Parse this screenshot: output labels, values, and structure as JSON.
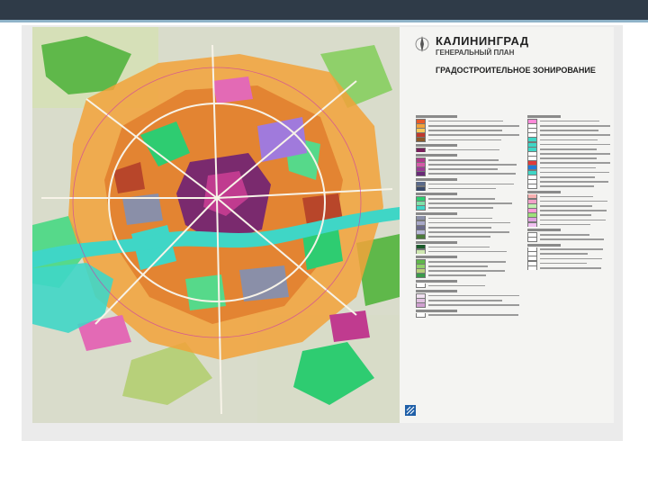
{
  "header": {
    "bar_color": "#2f3b48",
    "accent_line": "#8fb3c8"
  },
  "title": {
    "city": "КАЛИНИНГРАД",
    "plan": "ГЕНЕРАЛЬНЫЙ ПЛАН",
    "subtitle": "ГРАДОСТРОИТЕЛЬНОЕ ЗОНИРОВАНИЕ"
  },
  "map": {
    "icons": [
      "compass-icon",
      "logo-icon"
    ],
    "colors": {
      "residential_low": "#f2a23a",
      "residential_mid": "#e07a2a",
      "residential_high": "#b8462a",
      "public": "#7a2a6e",
      "business": "#c03b8f",
      "industrial": "#8a8fa8",
      "transport": "#a07adc",
      "green": "#2ecc71",
      "park": "#56d98a",
      "forest": "#5fb84a",
      "agri": "#b7d07a",
      "water": "#3fd6c6",
      "special": "#e36ab5"
    }
  },
  "legend": {
    "left_column": [
      {
        "type": "heading"
      },
      {
        "type": "item",
        "color": "#e85a2a"
      },
      {
        "type": "item",
        "color": "#f2a23a"
      },
      {
        "type": "item",
        "color": "#f7c95a"
      },
      {
        "type": "item",
        "color": "#c0392b"
      },
      {
        "type": "item",
        "color": "#8b5a2b"
      },
      {
        "type": "heading"
      },
      {
        "type": "item",
        "color": "#7a1f5c"
      },
      {
        "type": "heading"
      },
      {
        "type": "item",
        "color": "#b03a8c"
      },
      {
        "type": "item",
        "color": "#d45aa8"
      },
      {
        "type": "item",
        "color": "#9b3c94"
      },
      {
        "type": "item",
        "color": "#6a2a78"
      },
      {
        "type": "heading"
      },
      {
        "type": "item",
        "color": "#5a6a8a"
      },
      {
        "type": "item",
        "color": "#3a4a6a"
      },
      {
        "type": "heading"
      },
      {
        "type": "item",
        "color": "#2ecc71"
      },
      {
        "type": "item",
        "color": "#7fe0a8"
      },
      {
        "type": "item",
        "color": "#3fd6c6"
      },
      {
        "type": "heading"
      },
      {
        "type": "item",
        "color": "#8a8fa8"
      },
      {
        "type": "item",
        "color": "#a8a8c8"
      },
      {
        "type": "item",
        "color": "#6a6a88"
      },
      {
        "type": "item",
        "color": "#b8b8d8"
      },
      {
        "type": "item",
        "color": "#4a7a3a"
      },
      {
        "type": "heading"
      },
      {
        "type": "item",
        "color": "#1a5a2a"
      },
      {
        "type": "item",
        "color": "#cfe8b0"
      },
      {
        "type": "heading"
      },
      {
        "type": "item",
        "color": "#5fb84a"
      },
      {
        "type": "item",
        "color": "#8fd06a"
      },
      {
        "type": "item",
        "color": "#b7d07a"
      },
      {
        "type": "item",
        "color": "#3a9a4a"
      },
      {
        "type": "heading"
      },
      {
        "type": "item",
        "color": "#ffffff"
      },
      {
        "type": "heading"
      },
      {
        "type": "item",
        "color": "#f0e0f0"
      },
      {
        "type": "item",
        "color": "#e0c0e0"
      },
      {
        "type": "item",
        "color": "#d0a0d0"
      },
      {
        "type": "heading"
      },
      {
        "type": "item",
        "color": "#ffffff"
      }
    ],
    "right_column": [
      {
        "type": "heading"
      },
      {
        "type": "item",
        "color": "#ff8ad8"
      },
      {
        "type": "item",
        "color": "#ffffff"
      },
      {
        "type": "item",
        "color": "#ffffff"
      },
      {
        "type": "item",
        "color": "#ffffff"
      },
      {
        "type": "item",
        "color": "#3fd6c6"
      },
      {
        "type": "item",
        "color": "#3fd6c6"
      },
      {
        "type": "item",
        "color": "#3fd6c6"
      },
      {
        "type": "item",
        "color": "#ffffff"
      },
      {
        "type": "item",
        "color": "#ffffff"
      },
      {
        "type": "item",
        "color": "#e03a3a"
      },
      {
        "type": "item",
        "color": "#1f7ad8"
      },
      {
        "type": "item",
        "color": "#3fd6c6"
      },
      {
        "type": "item",
        "color": "#ffffff"
      },
      {
        "type": "item",
        "color": "#ffffff"
      },
      {
        "type": "item",
        "color": "#ffffff"
      },
      {
        "type": "heading"
      },
      {
        "type": "item",
        "color": "#f7b0b0"
      },
      {
        "type": "item",
        "color": "#f2a0c8"
      },
      {
        "type": "item",
        "color": "#c0f0b0"
      },
      {
        "type": "item",
        "color": "#ff9ad8"
      },
      {
        "type": "item",
        "color": "#9ee07a"
      },
      {
        "type": "item",
        "color": "#e0a0e0"
      },
      {
        "type": "item",
        "color": "#f0c0f0"
      },
      {
        "type": "heading"
      },
      {
        "type": "item",
        "color": "#ffffff"
      },
      {
        "type": "item",
        "color": "#ffffff"
      },
      {
        "type": "heading"
      },
      {
        "type": "item",
        "color": "#ffffff"
      },
      {
        "type": "item",
        "color": "#ffffff"
      },
      {
        "type": "item",
        "color": "#ffffff"
      },
      {
        "type": "item",
        "color": "#ffffff"
      },
      {
        "type": "item",
        "color": "#ffffff"
      }
    ]
  }
}
